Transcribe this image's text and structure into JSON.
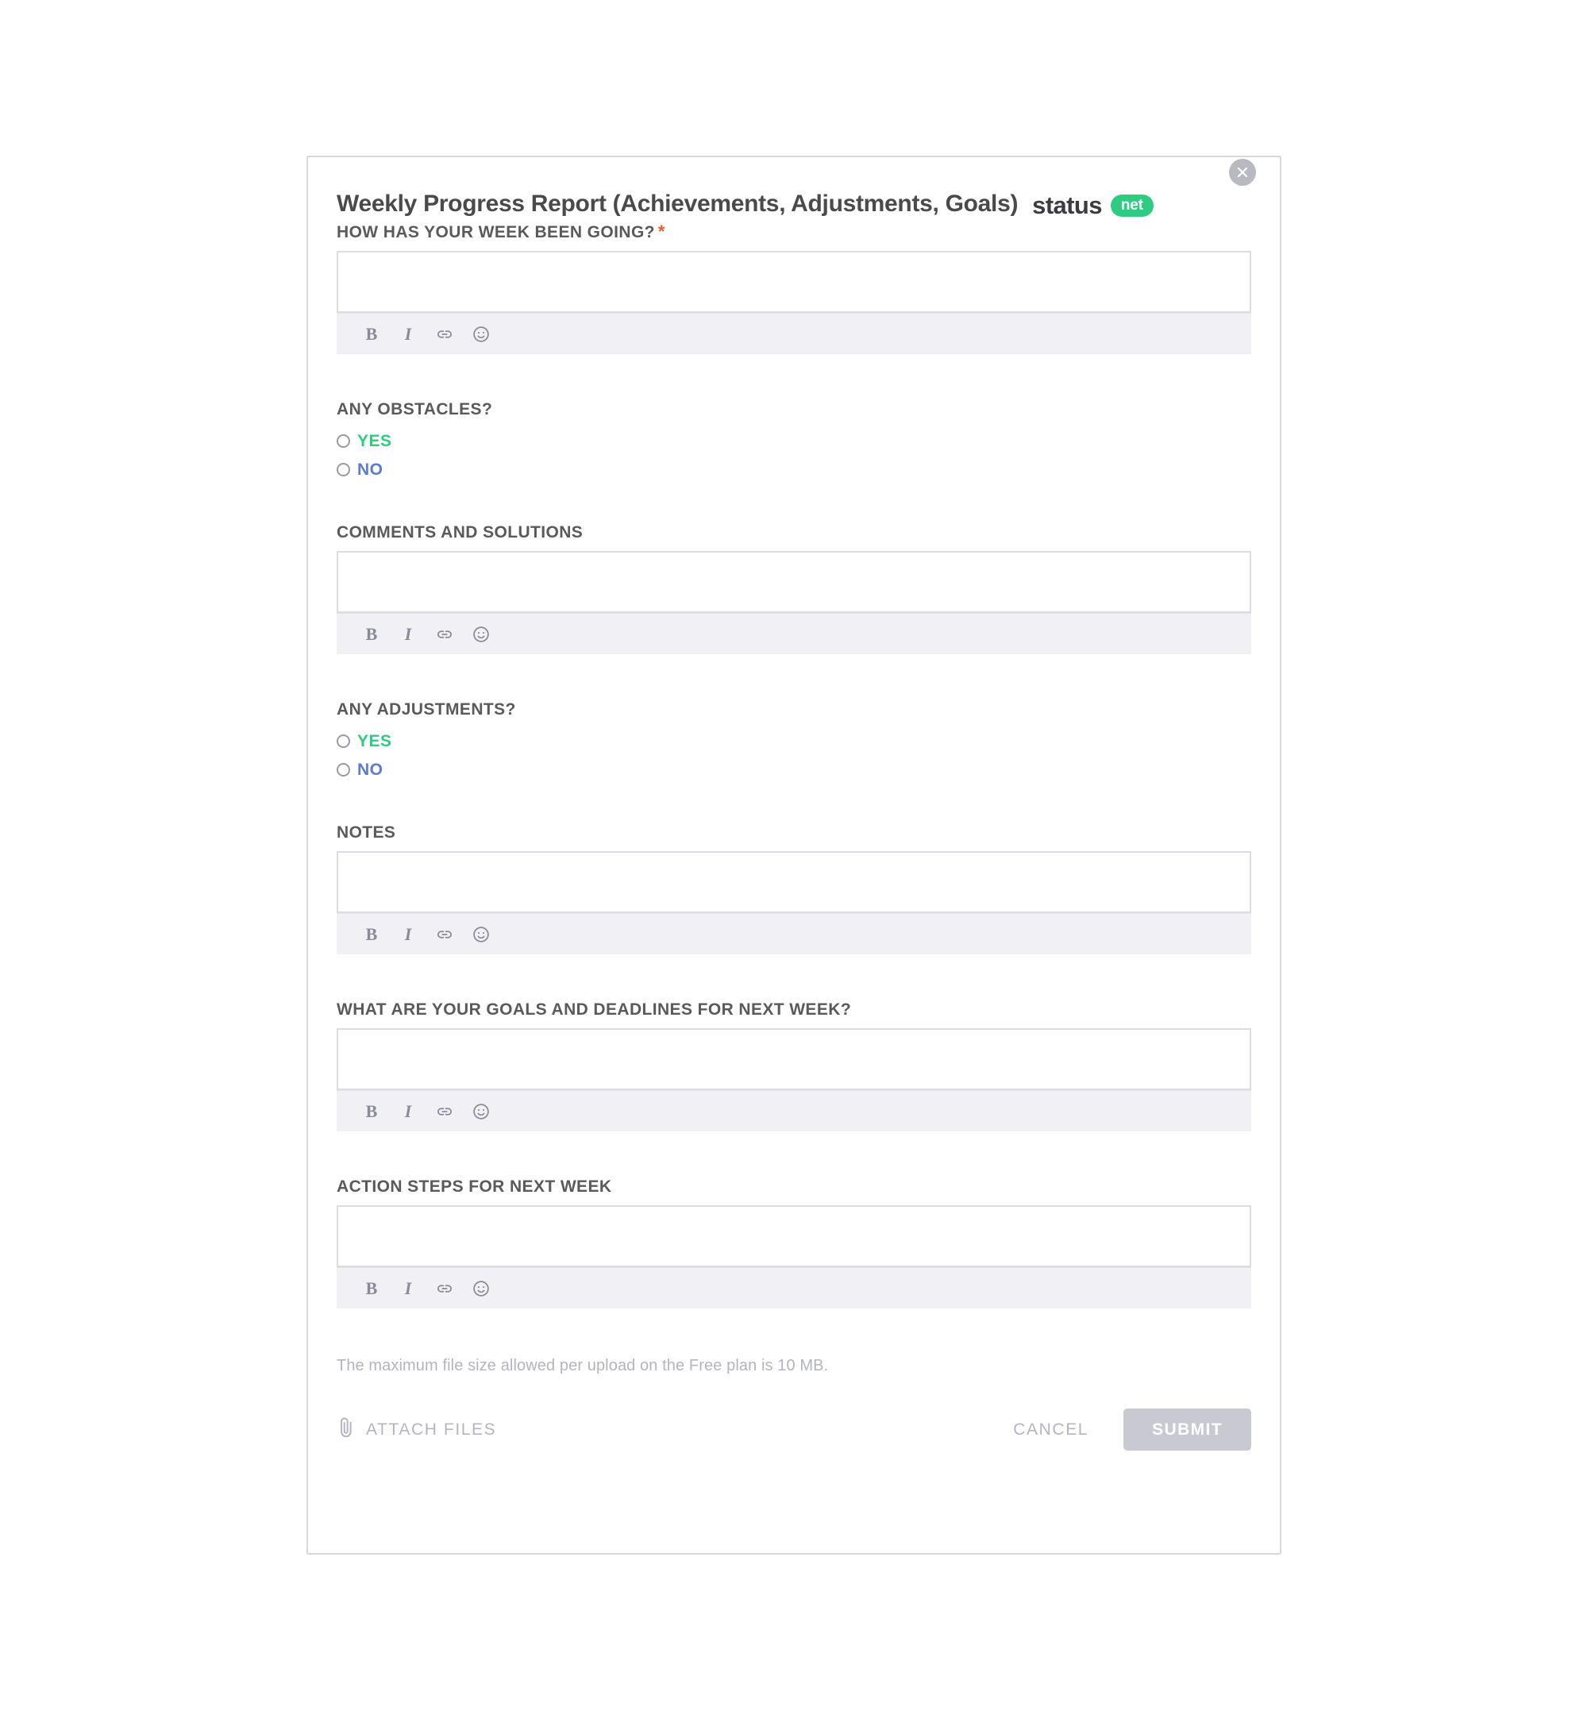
{
  "modal": {
    "title": "Weekly Progress Report (Achievements, Adjustments, Goals)",
    "brand": {
      "word": "status",
      "pill": "net"
    },
    "close_icon": "close-icon",
    "accent_green": "#2ecc80",
    "accent_blue": "#5b7bd5",
    "required_color": "#f2582a"
  },
  "toolbar": {
    "bold": "B",
    "italic": "I",
    "link_icon": "link-icon",
    "emoji_icon": "emoji-icon"
  },
  "fields": {
    "week_going": {
      "label": "HOW HAS YOUR WEEK BEEN GOING?",
      "required_mark": "*",
      "value": ""
    },
    "obstacles": {
      "label": "ANY OBSTACLES?",
      "options": [
        {
          "label": "YES",
          "selected": false
        },
        {
          "label": "NO",
          "selected": false
        }
      ]
    },
    "comments": {
      "label": "COMMENTS AND SOLUTIONS",
      "value": ""
    },
    "adjustments": {
      "label": "ANY ADJUSTMENTS?",
      "options": [
        {
          "label": "YES",
          "selected": false
        },
        {
          "label": "NO",
          "selected": false
        }
      ]
    },
    "notes": {
      "label": "NOTES",
      "value": ""
    },
    "goals": {
      "label": "WHAT ARE YOUR GOALS AND DEADLINES FOR NEXT WEEK?",
      "value": ""
    },
    "action_steps": {
      "label": "ACTION STEPS FOR NEXT WEEK",
      "value": ""
    }
  },
  "footer": {
    "note": "The maximum file size allowed per upload on the Free plan is 10 MB.",
    "attach_label": "ATTACH FILES",
    "attach_icon": "paperclip-icon",
    "cancel_label": "CANCEL",
    "submit_label": "SUBMIT"
  }
}
